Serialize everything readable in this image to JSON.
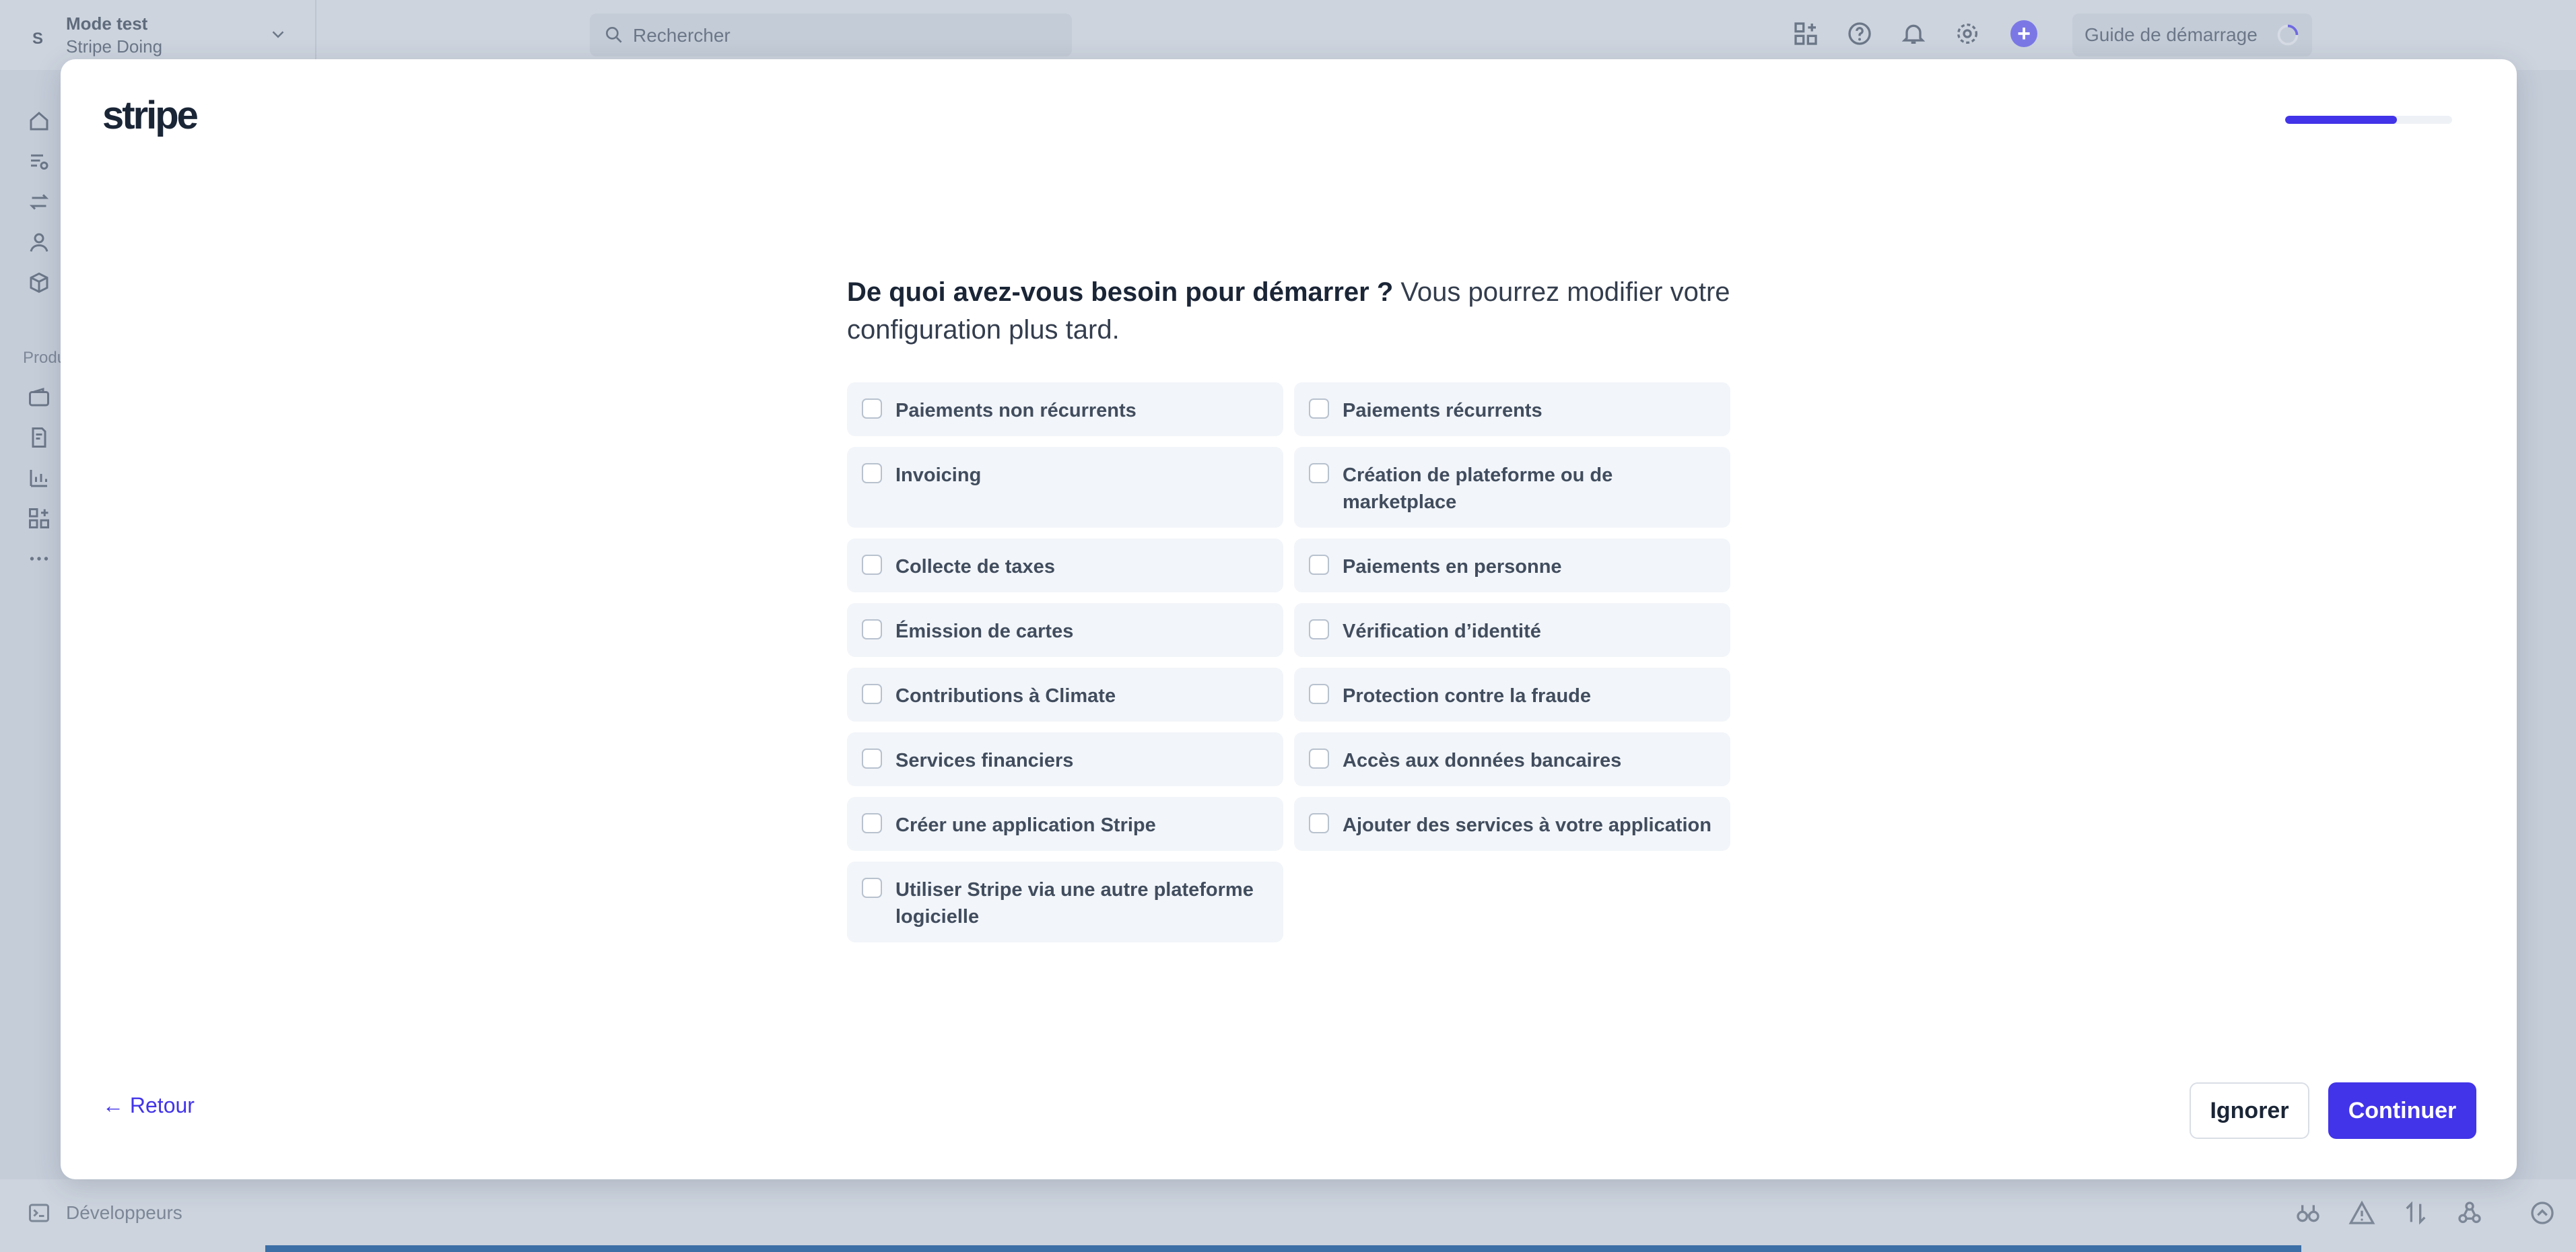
{
  "background": {
    "account": {
      "avatar_letter": "S",
      "title": "Mode test",
      "subtitle": "Stripe Doing"
    },
    "search": {
      "placeholder": "Rechercher"
    },
    "setup_guide_label": "Guide de démarrage",
    "sidebar_section_label": "Produ",
    "developers_label": "Développeurs"
  },
  "modal": {
    "logo": "stripe",
    "progress": 0.67,
    "question_strong": "De quoi avez-vous besoin pour démarrer ?",
    "question_rest": "Vous pourrez modifier votre configuration plus tard.",
    "options": [
      "Paiements non récurrents",
      "Paiements récurrents",
      "Invoicing",
      "Création de plateforme ou de marketplace",
      "Collecte de taxes",
      "Paiements en personne",
      "Émission de cartes",
      "Vérification d’identité",
      "Contributions à Climate",
      "Protection contre la fraude",
      "Services financiers",
      "Accès aux données bancaires",
      "Créer une application Stripe",
      "Ajouter des services à votre application",
      "Utiliser Stripe via une autre plateforme logicielle"
    ],
    "back_label": "← Retour",
    "ignore_label": "Ignorer",
    "continue_label": "Continuer"
  },
  "colors": {
    "accent": "#4234e8",
    "option_bg": "#f2f5f9",
    "heading": "#1a2536"
  }
}
